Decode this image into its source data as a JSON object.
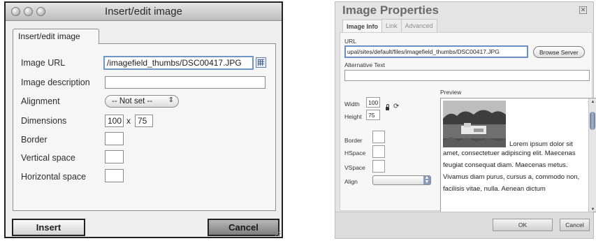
{
  "left_dialog": {
    "title": "Insert/edit image",
    "tab": "Insert/edit image",
    "image_url_label": "Image URL",
    "image_url_value": "/imagefield_thumbs/DSC00417.JPG",
    "image_description_label": "Image description",
    "image_description_value": "",
    "alignment_label": "Alignment",
    "alignment_value": "-- Not set --",
    "dimensions_label": "Dimensions",
    "width": "100",
    "dimension_separator": "x",
    "height": "75",
    "border_label": "Border",
    "vertical_space_label": "Vertical space",
    "horizontal_space_label": "Horizontal space",
    "insert_button": "Insert",
    "cancel_button": "Cancel"
  },
  "right_dialog": {
    "title": "Image Properties",
    "tabs": [
      "Image Info",
      "Link",
      "Advanced"
    ],
    "active_tab": "Image Info",
    "url_label": "URL",
    "url_value": "upal/sites/default/files/imagefield_thumbs/DSC00417.JPG",
    "browse_server_button": "Browse Server",
    "alt_text_label": "Alternative Text",
    "width_label": "Width",
    "width_value": "100",
    "height_label": "Height",
    "height_value": "75",
    "preview_label": "Preview",
    "border_label": "Border",
    "hspace_label": "HSpace",
    "vspace_label": "VSpace",
    "align_label": "Align",
    "preview_text_first": "Lorem ipsum dolor sit",
    "preview_text_rest": "amet, consectetuer adipiscing elit. Maecenas feugiat consequat diam. Maecenas metus. Vivamus diam purus, cursus a, commodo non, facilisis vitae, nulla. Aenean dictum",
    "ok_button": "OK",
    "cancel_button": "Cancel"
  },
  "icons": {
    "left_browse": "grid-browse-icon",
    "lock": "lock-icon",
    "reset": "reset-size-icon",
    "close": "close-icon"
  }
}
